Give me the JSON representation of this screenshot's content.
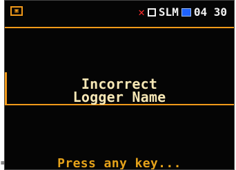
{
  "device": {
    "status": {
      "left_icon": "sd-card-icon",
      "logger_icon": "red-logger-icon",
      "mode": "SLM",
      "time": "04 30",
      "accent_color": "#f29a1a",
      "blue_indicator": "#1e62ff"
    },
    "message": {
      "line1": "Incorrect",
      "line2": "Logger Name"
    },
    "prompt": "Press any key..."
  },
  "annotation": {
    "arrow": "=>"
  }
}
